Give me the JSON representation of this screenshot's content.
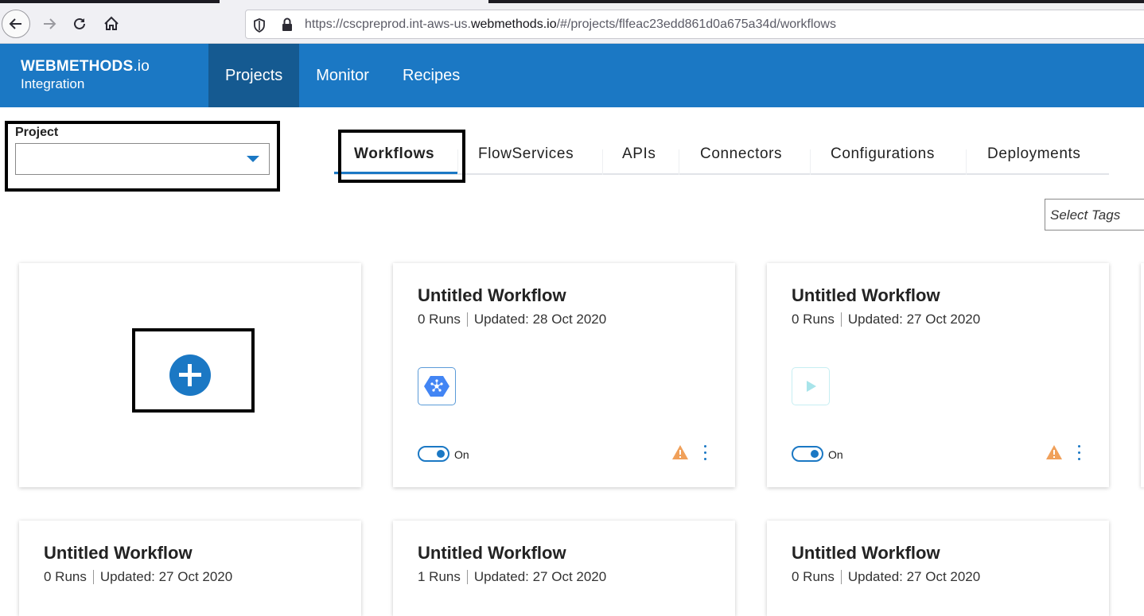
{
  "browser": {
    "url_prefix": "https://cscpreprod.int-aws-us.",
    "url_host": "webmethods.io",
    "url_suffix": "/#/projects/flfeac23edd861d0a675a34d/workflows"
  },
  "header": {
    "logo_main": "WEBMETHODS",
    "logo_suffix": ".io",
    "logo_sub": "Integration",
    "nav": [
      {
        "label": "Projects",
        "active": true
      },
      {
        "label": "Monitor",
        "active": false
      },
      {
        "label": "Recipes",
        "active": false
      }
    ]
  },
  "project": {
    "label": "Project",
    "selected_value": ""
  },
  "tabs": [
    {
      "label": "Workflows",
      "active": true
    },
    {
      "label": "FlowServices",
      "active": false
    },
    {
      "label": "APIs",
      "active": false
    },
    {
      "label": "Connectors",
      "active": false
    },
    {
      "label": "Configurations",
      "active": false
    },
    {
      "label": "Deployments",
      "active": false
    }
  ],
  "tags": {
    "placeholder": "Select Tags"
  },
  "workflows": [
    {
      "title": "Untitled Workflow",
      "runs": "0 Runs",
      "updated": "Updated: 28 Oct 2020",
      "icon": "google-cloud-icon",
      "toggle": "On"
    },
    {
      "title": "Untitled Workflow",
      "runs": "0 Runs",
      "updated": "Updated: 27 Oct 2020",
      "icon": "play-icon",
      "toggle": "On"
    },
    {
      "title": "Untitled Workflow",
      "runs": "0 Runs",
      "updated": "Updated: 27 Oct 2020"
    },
    {
      "title": "Untitled Workflow",
      "runs": "1 Runs",
      "updated": "Updated: 27 Oct 2020"
    },
    {
      "title": "Untitled Workflow",
      "runs": "0 Runs",
      "updated": "Updated: 27 Oct 2020"
    }
  ],
  "colors": {
    "brand": "#1b78c4",
    "brand_active": "#155a91",
    "warning": "#f0a05a"
  }
}
